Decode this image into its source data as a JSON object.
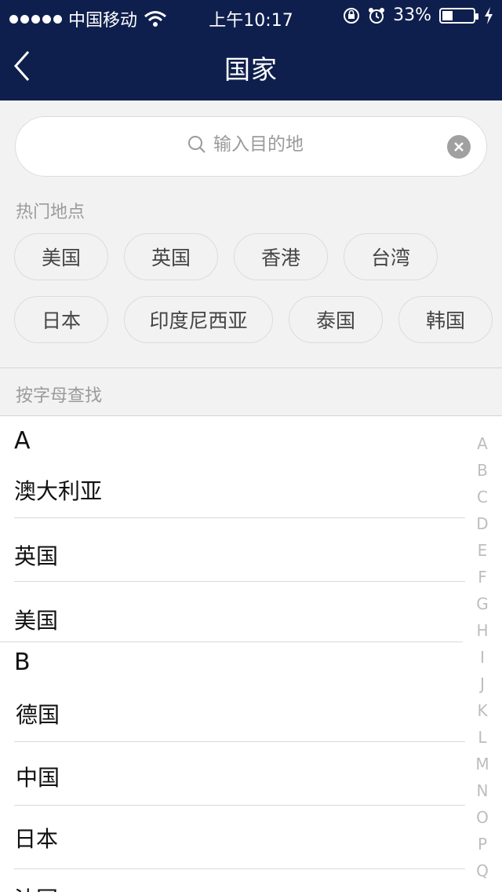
{
  "status_bar": {
    "carrier": "中国移动",
    "time": "上午10:17",
    "battery": "33%",
    "battery_level": 0.33
  },
  "nav": {
    "title": "国家"
  },
  "search": {
    "placeholder": "输入目的地"
  },
  "hot": {
    "label": "热门地点",
    "items": [
      "美国",
      "英国",
      "香港",
      "台湾",
      "日本",
      "印度尼西亚",
      "泰国",
      "韩国"
    ]
  },
  "by_letter": {
    "label": "按字母查找"
  },
  "groups": [
    {
      "letter": "A",
      "items": [
        "澳大利亚",
        "英国",
        "美国"
      ]
    },
    {
      "letter": "B",
      "items": [
        "德国",
        "中国",
        "日本",
        "法国"
      ]
    }
  ],
  "index": [
    "A",
    "B",
    "C",
    "D",
    "E",
    "F",
    "G",
    "H",
    "I",
    "J",
    "K",
    "L",
    "M",
    "N",
    "O",
    "P",
    "Q"
  ]
}
